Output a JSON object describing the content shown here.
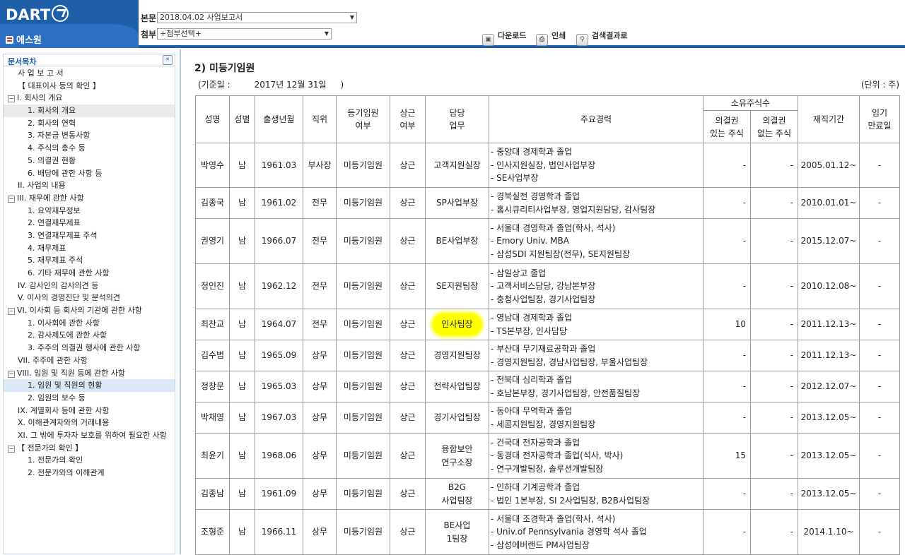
{
  "header": {
    "logo": "DART",
    "brand": "에스원",
    "main_doc_label": "본문",
    "main_doc_value": "2018.04.02  사업보고서",
    "attach_label": "첨부",
    "attach_value": "+첨부선택+",
    "download_label": "다운로드",
    "print_label": "인쇄",
    "search_result_label": "검색결과로"
  },
  "sidebar": {
    "title": "문서목차",
    "items": [
      {
        "label": "사 업 보 고 서",
        "level": 1,
        "toggle": false
      },
      {
        "label": "【 대표이사 등의 확인 】",
        "level": 1,
        "toggle": false
      },
      {
        "label": "I. 회사의 개요",
        "level": 0,
        "toggle": true
      },
      {
        "label": "1. 회사의 개요",
        "level": 2,
        "toggle": false
      },
      {
        "label": "2. 회사의 연혁",
        "level": 2,
        "toggle": false
      },
      {
        "label": "3. 자본금 변동사항",
        "level": 2,
        "toggle": false
      },
      {
        "label": "4. 주식의 총수 등",
        "level": 2,
        "toggle": false
      },
      {
        "label": "5. 의결권 현황",
        "level": 2,
        "toggle": false
      },
      {
        "label": "6. 배당에 관한 사항 등",
        "level": 2,
        "toggle": false
      },
      {
        "label": "II. 사업의 내용",
        "level": 1,
        "toggle": false
      },
      {
        "label": "III. 재무에 관한 사항",
        "level": 0,
        "toggle": true
      },
      {
        "label": "1. 요약재무정보",
        "level": 2,
        "toggle": false
      },
      {
        "label": "2. 연결재무제표",
        "level": 2,
        "toggle": false
      },
      {
        "label": "3. 연결재무제표 주석",
        "level": 2,
        "toggle": false
      },
      {
        "label": "4. 재무제표",
        "level": 2,
        "toggle": false
      },
      {
        "label": "5. 재무제표 주석",
        "level": 2,
        "toggle": false
      },
      {
        "label": "6. 기타 재무에 관한 사항",
        "level": 2,
        "toggle": false
      },
      {
        "label": "IV. 감사인의 감사의견 등",
        "level": 1,
        "toggle": false
      },
      {
        "label": "V. 이사의 경영진단 및 분석의견",
        "level": 1,
        "toggle": false
      },
      {
        "label": "VI. 이사회 등 회사의 기관에 관한 사항",
        "level": 0,
        "toggle": true
      },
      {
        "label": "1. 이사회에 관한 사항",
        "level": 2,
        "toggle": false
      },
      {
        "label": "2. 감사제도에 관한 사항",
        "level": 2,
        "toggle": false
      },
      {
        "label": "3. 주주의 의결권 행사에 관한 사항",
        "level": 2,
        "toggle": false
      },
      {
        "label": "VII. 주주에 관한 사항",
        "level": 1,
        "toggle": false
      },
      {
        "label": "VIII. 임원 및 직원 등에 관한 사항",
        "level": 0,
        "toggle": true
      },
      {
        "label": "1. 임원 및 직원의 현황",
        "level": 2,
        "toggle": false
      },
      {
        "label": "2. 임원의 보수 등",
        "level": 2,
        "toggle": false
      },
      {
        "label": "IX. 계열회사 등에 관한 사항",
        "level": 1,
        "toggle": false
      },
      {
        "label": "X. 이해관계자와의 거래내용",
        "level": 1,
        "toggle": false
      },
      {
        "label": "XI. 그 밖에 투자자 보호를 위하여 필요한 사항",
        "level": 1,
        "toggle": false
      },
      {
        "label": "【 전문가의 확인 】",
        "level": 0,
        "toggle": true
      },
      {
        "label": "1. 전문가의 확인",
        "level": 2,
        "toggle": false
      },
      {
        "label": "2. 전문가와의 이해관계",
        "level": 2,
        "toggle": false
      }
    ],
    "selected_index": 25,
    "hover_index": 3
  },
  "content": {
    "section_title": "2) 미등기임원",
    "base_date_label": "(기준일 :",
    "base_date_value": "2017년 12월 31일",
    "base_date_close": ")",
    "unit": "(단위 : 주)",
    "headers": {
      "name": "성명",
      "gender": "성별",
      "birth": "출생년월",
      "position": "직위",
      "registered": [
        "등기임원",
        "여부"
      ],
      "fulltime": [
        "상근",
        "여부"
      ],
      "duty": [
        "담당",
        "업무"
      ],
      "career": "주요경력",
      "shares_group": "소유주식수",
      "voting": [
        "의결권",
        "있는 주식"
      ],
      "nonvoting": [
        "의결권",
        "없는 주식"
      ],
      "tenure": "재직기간",
      "term": [
        "임기",
        "만료일"
      ]
    },
    "rows": [
      {
        "name": "박영수",
        "gender": "남",
        "birth": "1961.03",
        "position": "부사장",
        "registered": "미등기임원",
        "fulltime": "상근",
        "duty": [
          "고객지원실장"
        ],
        "career": [
          "- 중앙대 경제학과 졸업",
          "- 인사지원실장, 법인사업부장",
          "- SE사업부장"
        ],
        "voting": "-",
        "nonvoting": "-",
        "tenure": "2005.01.12~",
        "term": "-"
      },
      {
        "name": "김종국",
        "gender": "남",
        "birth": "1961.02",
        "position": "전무",
        "registered": "미등기임원",
        "fulltime": "상근",
        "duty": [
          "SP사업부장"
        ],
        "career": [
          "- 경북실전 경영학과 졸업",
          "- 홈시큐리티사업부장, 영업지원담당, 감사팀장"
        ],
        "voting": "-",
        "nonvoting": "-",
        "tenure": "2010.01.01~",
        "term": "-"
      },
      {
        "name": "권영기",
        "gender": "남",
        "birth": "1966.07",
        "position": "전무",
        "registered": "미등기임원",
        "fulltime": "상근",
        "duty": [
          "BE사업부장"
        ],
        "career": [
          "- 서울대 경영학과 졸업(학사, 석사)",
          "- Emory Univ. MBA",
          "- 삼성SDI 지원팀장(전무), SE지원팀장"
        ],
        "voting": "-",
        "nonvoting": "-",
        "tenure": "2015.12.07~",
        "term": "-"
      },
      {
        "name": "정인진",
        "gender": "남",
        "birth": "1962.12",
        "position": "전무",
        "registered": "미등기임원",
        "fulltime": "상근",
        "duty": [
          "SE지원팀장"
        ],
        "career": [
          "- 삼일상고 졸업",
          "- 고객서비스담당, 강남본부장",
          "- 충청사업팀장, 경기사업팀장"
        ],
        "voting": "-",
        "nonvoting": "-",
        "tenure": "2010.12.08~",
        "term": "-"
      },
      {
        "name": "최찬교",
        "gender": "남",
        "birth": "1964.07",
        "position": "전무",
        "registered": "미등기임원",
        "fulltime": "상근",
        "duty": [
          "인사팀장"
        ],
        "highlight": true,
        "career": [
          "- 영남대 경제학과 졸업",
          "- TS본부장, 인사담당"
        ],
        "voting": "10",
        "nonvoting": "-",
        "tenure": "2011.12.13~",
        "term": "-"
      },
      {
        "name": "김수범",
        "gender": "남",
        "birth": "1965.09",
        "position": "상무",
        "registered": "미등기임원",
        "fulltime": "상근",
        "duty": [
          "경영지원팀장"
        ],
        "career": [
          "- 부산대 무기재료공학과 졸업",
          "- 경영지원팀장, 경남사업팀장, 부울사업팀장"
        ],
        "voting": "-",
        "nonvoting": "-",
        "tenure": "2011.12.13~",
        "term": "-"
      },
      {
        "name": "정창문",
        "gender": "남",
        "birth": "1965.03",
        "position": "상무",
        "registered": "미등기임원",
        "fulltime": "상근",
        "duty": [
          "전략사업팀장"
        ],
        "career": [
          "- 전북대 심리학과 졸업",
          "- 호남본부장, 경기사업팀장, 안전품질팀장"
        ],
        "voting": "-",
        "nonvoting": "-",
        "tenure": "2012.12.07~",
        "term": "-"
      },
      {
        "name": "박채영",
        "gender": "남",
        "birth": "1967.03",
        "position": "상무",
        "registered": "미등기임원",
        "fulltime": "상근",
        "duty": [
          "경기사업팀장"
        ],
        "career": [
          "- 동아대 무역학과 졸업",
          "- 세콤지원팀장, 경영지원팀장"
        ],
        "voting": "-",
        "nonvoting": "-",
        "tenure": "2013.12.05~",
        "term": "-"
      },
      {
        "name": "최윤기",
        "gender": "남",
        "birth": "1968.06",
        "position": "상무",
        "registered": "미등기임원",
        "fulltime": "상근",
        "duty": [
          "융합보안",
          "연구소장"
        ],
        "career": [
          "- 건국대 전자공학과 졸업",
          "- 동경대 전자공학과 졸업(석사, 박사)",
          "- 연구개발팀장, 솔루션개발팀장"
        ],
        "voting": "15",
        "nonvoting": "-",
        "tenure": "2013.12.05~",
        "term": "-"
      },
      {
        "name": "김종남",
        "gender": "남",
        "birth": "1961.09",
        "position": "상무",
        "registered": "미등기임원",
        "fulltime": "상근",
        "duty": [
          "B2G",
          "사업팀장"
        ],
        "career": [
          "- 인하대 기계공학과 졸업",
          "- 법인 1본부장, SI 2사업팀장, B2B사업팀장"
        ],
        "voting": "-",
        "nonvoting": "-",
        "tenure": "2013.12.05~",
        "term": "-"
      },
      {
        "name": "조형준",
        "gender": "남",
        "birth": "1966.11",
        "position": "상무",
        "registered": "미등기임원",
        "fulltime": "상근",
        "duty": [
          "BE사업",
          "1팀장"
        ],
        "career": [
          "- 서울대 조경학과 졸업(학사, 석사)",
          "- Univ.of Pennsylvania 경영학 석사 졸업",
          "- 삼성에버랜드 PM사업팀장"
        ],
        "voting": "-",
        "nonvoting": "-",
        "tenure": "2014.1.10~",
        "term": "-"
      }
    ]
  }
}
